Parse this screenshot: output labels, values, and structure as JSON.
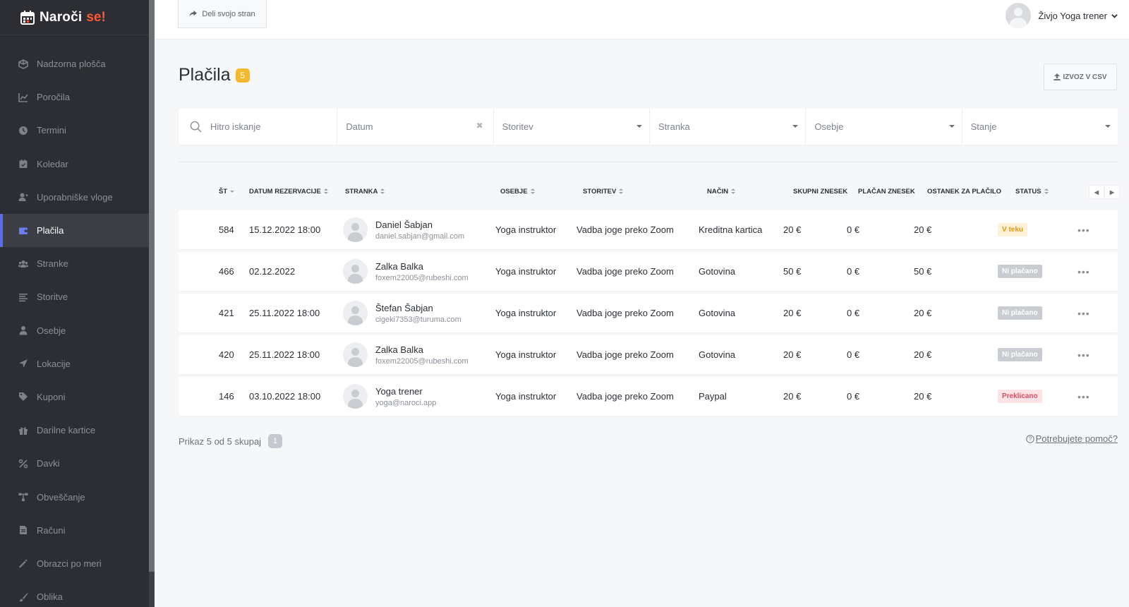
{
  "brand": {
    "name": "Naroči",
    "accent": "se!"
  },
  "sidebar": {
    "items": [
      {
        "label": "Nadzorna plošča",
        "icon": "cube-icon"
      },
      {
        "label": "Poročila",
        "icon": "chart-icon"
      },
      {
        "label": "Termini",
        "icon": "clock-icon"
      },
      {
        "label": "Koledar",
        "icon": "calendar-check-icon"
      },
      {
        "label": "Uporabniške vloge",
        "icon": "user-plus-icon"
      },
      {
        "label": "Plačila",
        "icon": "wallet-icon",
        "active": true
      },
      {
        "label": "Stranke",
        "icon": "users-icon"
      },
      {
        "label": "Storitve",
        "icon": "list-icon"
      },
      {
        "label": "Osebje",
        "icon": "user-icon"
      },
      {
        "label": "Lokacije",
        "icon": "location-arrow-icon"
      },
      {
        "label": "Kuponi",
        "icon": "tag-icon"
      },
      {
        "label": "Darilne kartice",
        "icon": "gift-icon"
      },
      {
        "label": "Davki",
        "icon": "percent-icon"
      },
      {
        "label": "Obveščanje",
        "icon": "flow-icon"
      },
      {
        "label": "Računi",
        "icon": "invoice-icon"
      },
      {
        "label": "Obrazci po meri",
        "icon": "magic-wand-icon"
      },
      {
        "label": "Oblika",
        "icon": "brush-icon"
      }
    ]
  },
  "topbar": {
    "share_label": "Deli svojo stran",
    "user_greeting": "Živjo Yoga trener"
  },
  "page": {
    "title": "Plačila",
    "count": "5",
    "export_label": "IZVOZ V CSV"
  },
  "filters": {
    "search_placeholder": "Hitro iskanje",
    "date_placeholder": "Datum",
    "service_label": "Storitev",
    "customer_label": "Stranka",
    "staff_label": "Osebje",
    "status_label": "Stanje"
  },
  "table": {
    "headers": {
      "id": "ŠT",
      "date": "DATUM REZERVACIJE",
      "customer": "STRANKA",
      "staff": "OSEBJE",
      "service": "STORITEV",
      "method": "NAČIN",
      "total": "SKUPNI ZNESEK",
      "paid": "PLAČAN ZNESEK",
      "due": "OSTANEK ZA PLAČILO",
      "status": "STATUS"
    },
    "rows": [
      {
        "id": "584",
        "date": "15.12.2022 18:00",
        "name": "Daniel Šabjan",
        "email": "daniel.sabjan@gmail.com",
        "staff": "Yoga instruktor",
        "service": "Vadba joge preko Zoom",
        "method": "Kreditna kartica",
        "total": "20 €",
        "paid": "0 €",
        "due": "20 €",
        "status": "V teku",
        "status_kind": "progress"
      },
      {
        "id": "466",
        "date": "02.12.2022",
        "name": "Zalka Balka",
        "email": "foxem22005@rubeshi.com",
        "staff": "Yoga instruktor",
        "service": "Vadba joge preko Zoom",
        "method": "Gotovina",
        "total": "50 €",
        "paid": "0 €",
        "due": "50 €",
        "status": "Ni plačano",
        "status_kind": "unpaid"
      },
      {
        "id": "421",
        "date": "25.11.2022 18:00",
        "name": "Štefan Šabjan",
        "email": "cigeki7353@turuma.com",
        "staff": "Yoga instruktor",
        "service": "Vadba joge preko Zoom",
        "method": "Gotovina",
        "total": "20 €",
        "paid": "0 €",
        "due": "20 €",
        "status": "Ni plačano",
        "status_kind": "unpaid"
      },
      {
        "id": "420",
        "date": "25.11.2022 18:00",
        "name": "Zalka Balka",
        "email": "foxem22005@rubeshi.com",
        "staff": "Yoga instruktor",
        "service": "Vadba joge preko Zoom",
        "method": "Gotovina",
        "total": "20 €",
        "paid": "0 €",
        "due": "20 €",
        "status": "Ni plačano",
        "status_kind": "unpaid"
      },
      {
        "id": "146",
        "date": "03.10.2022 18:00",
        "name": "Yoga trener",
        "email": "yoga@naroci.app",
        "staff": "Yoga instruktor",
        "service": "Vadba joge preko Zoom",
        "method": "Paypal",
        "total": "20 €",
        "paid": "0 €",
        "due": "20 €",
        "status": "Preklicano",
        "status_kind": "cancel"
      }
    ]
  },
  "footer": {
    "summary": "Prikaz 5 od 5 skupaj",
    "page": "1",
    "help_label": "Potrebujete pomoč?"
  },
  "colors": {
    "sidebar_bg": "#2c2e33",
    "active_accent": "#5a6cf0",
    "brand_accent": "#ff5a36",
    "count_badge": "#f5b82e"
  }
}
